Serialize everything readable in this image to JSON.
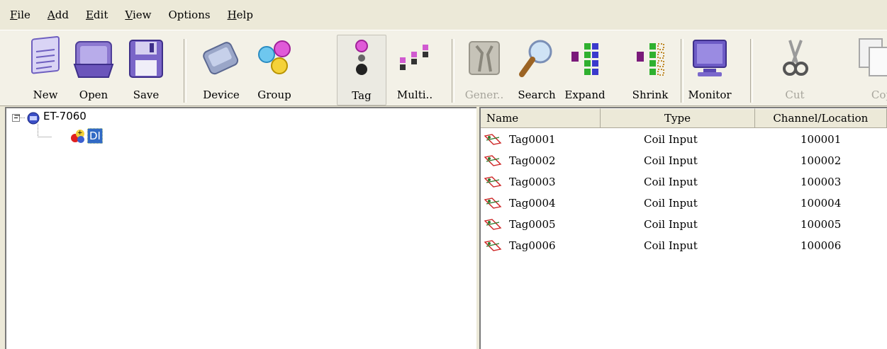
{
  "menu": {
    "items": [
      {
        "label": "File",
        "accel": "F",
        "rest": "ile"
      },
      {
        "label": "Add",
        "accel": "A",
        "rest": "dd"
      },
      {
        "label": "Edit",
        "accel": "E",
        "rest": "dit"
      },
      {
        "label": "View",
        "accel": "V",
        "rest": "iew"
      },
      {
        "label": "Options",
        "accel": "",
        "rest": "Options"
      },
      {
        "label": "Help",
        "accel": "H",
        "rest": "elp"
      }
    ]
  },
  "toolbar": {
    "new_label": "New",
    "open_label": "Open",
    "save_label": "Save",
    "device_label": "Device",
    "group_label": "Group",
    "tag_label": "Tag",
    "multi_label": "Multi..",
    "general_label": "Gener..",
    "search_label": "Search",
    "expand_label": "Expand",
    "shrink_label": "Shrink",
    "monitor_label": "Monitor",
    "cut_label": "Cut",
    "copy_label": "Cop"
  },
  "tree": {
    "root_label": "ET-7060",
    "child_label": "DI",
    "expander": "−"
  },
  "list": {
    "columns": [
      "Name",
      "Type",
      "Channel/Location"
    ],
    "rows": [
      {
        "name": "Tag0001",
        "type": "Coil Input",
        "location": "100001"
      },
      {
        "name": "Tag0002",
        "type": "Coil Input",
        "location": "100002"
      },
      {
        "name": "Tag0003",
        "type": "Coil Input",
        "location": "100003"
      },
      {
        "name": "Tag0004",
        "type": "Coil Input",
        "location": "100004"
      },
      {
        "name": "Tag0005",
        "type": "Coil Input",
        "location": "100005"
      },
      {
        "name": "Tag0006",
        "type": "Coil Input",
        "location": "100006"
      }
    ]
  },
  "colors": {
    "face": "#ece9d8",
    "selection": "#316ac5",
    "disabled_text": "#a7a59c"
  }
}
